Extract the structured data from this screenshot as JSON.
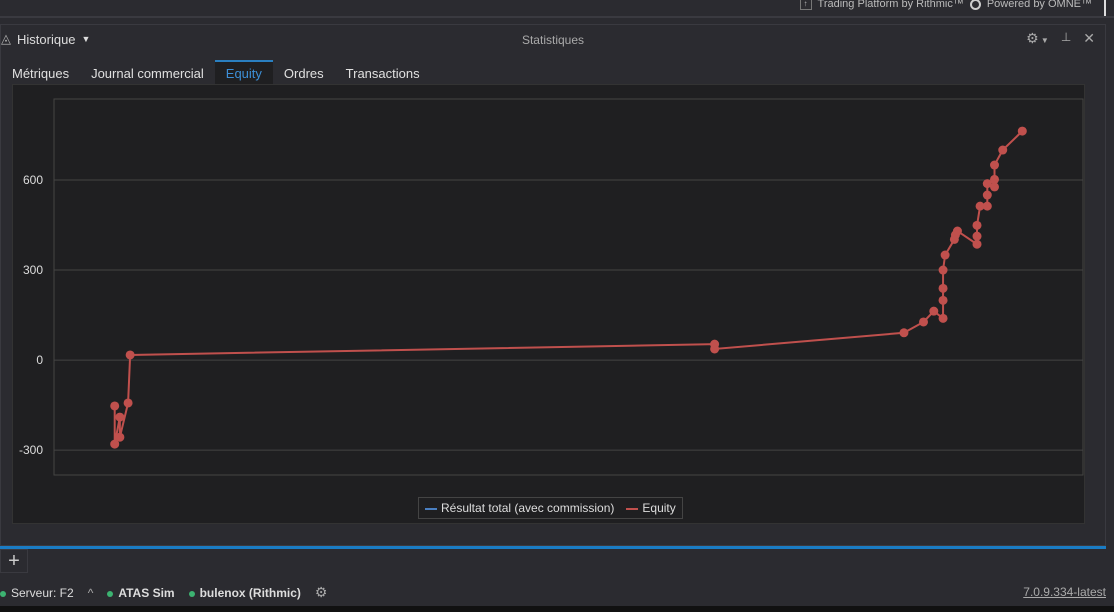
{
  "topbar": {
    "rithmic": "Trading Platform by Rithmic™",
    "omne": "Powered by OMNE™"
  },
  "panel": {
    "history_label": "Historique",
    "title": "Statistiques"
  },
  "tabs": [
    {
      "label": "Métriques"
    },
    {
      "label": "Journal commercial"
    },
    {
      "label": "Equity",
      "active": true
    },
    {
      "label": "Ordres"
    },
    {
      "label": "Transactions"
    }
  ],
  "status": {
    "server": "Serveur: F2",
    "sim": "ATAS Sim",
    "account": "bulenox (Rithmic)",
    "version": "7.0.9.334-latest"
  },
  "colors": {
    "equity": "#c0504d",
    "total": "#4a7fc1",
    "accent": "#1a7cc4"
  },
  "chart_data": {
    "type": "line",
    "title": "",
    "xlabel": "",
    "ylabel": "",
    "xlim": [
      0,
      100
    ],
    "ylim": [
      -383,
      870
    ],
    "yticks": [
      -300,
      0,
      300,
      600
    ],
    "grid": true,
    "legend_placement": "bottom-center",
    "legend": [
      "Résultat total (avec commission)",
      "Equity"
    ],
    "series": [
      {
        "name": "Résultat total (avec commission)",
        "x": [],
        "y": []
      },
      {
        "name": "Equity",
        "x": [
          5.9,
          5.9,
          6.4,
          6.4,
          7.2,
          7.4,
          64.2,
          64.2,
          82.6,
          84.5,
          85.5,
          86.4,
          86.4,
          86.4,
          86.4,
          86.6,
          87.5,
          87.6,
          87.8,
          89.7,
          89.7,
          89.7,
          90.0,
          90.7,
          90.7,
          90.7,
          91.4,
          91.4,
          91.4,
          92.2,
          94.1
        ],
        "y": [
          -153,
          -280,
          -190,
          -257,
          -143,
          17,
          53,
          37,
          91,
          127,
          163,
          139,
          199,
          239,
          300,
          350,
          402,
          417,
          430,
          386,
          413,
          449,
          513,
          513,
          550,
          588,
          577,
          602,
          650,
          700,
          763
        ]
      }
    ]
  }
}
